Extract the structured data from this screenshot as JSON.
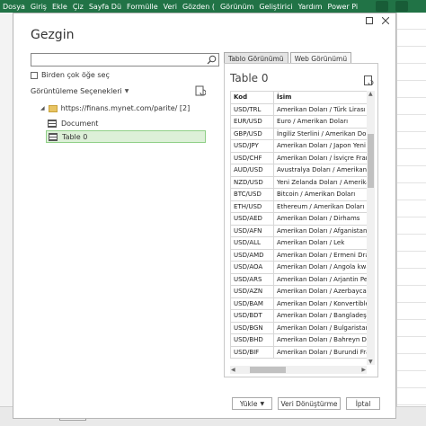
{
  "ribbon": {
    "tabs": [
      "Dosya",
      "Giriş",
      "Ekle",
      "Çiz",
      "Sayfa Dü",
      "Formülle",
      "Veri",
      "Gözden (",
      "Görünüm",
      "Geliştirici",
      "Yardım",
      "Power Pi"
    ]
  },
  "dialog": {
    "title": "Gezgin",
    "search": {
      "value": "",
      "placeholder": ""
    },
    "multi_select_label": "Birden çok öğe seç",
    "view_options_label": "Görüntüleme Seçenekleri",
    "tree": {
      "root_label": "https://finans.mynet.com/parite/ [2]",
      "items": [
        {
          "label": "Document",
          "selected": false
        },
        {
          "label": "Table 0",
          "selected": true
        }
      ]
    },
    "tabs": {
      "table_view": "Tablo Görünümü",
      "web_view": "Web Görünümü"
    },
    "preview": {
      "title": "Table 0",
      "columns": [
        "Kod",
        "İsim"
      ],
      "rows": [
        [
          "USD/TRL",
          "Amerikan Doları / Türk Lirası"
        ],
        [
          "EUR/USD",
          "Euro / Amerikan Doları"
        ],
        [
          "GBP/USD",
          "İngiliz Sterlini / Amerikan Dolar"
        ],
        [
          "USD/JPY",
          "Amerikan Doları / Japon Yeni"
        ],
        [
          "USD/CHF",
          "Amerikan Doları / İsviçre Frankı"
        ],
        [
          "AUD/USD",
          "Avustralya Doları / Amerikan Do"
        ],
        [
          "NZD/USD",
          "Yeni Zelanda Doları / Amerikan D"
        ],
        [
          "BTC/USD",
          "Bitcoin / Amerikan Doları"
        ],
        [
          "ETH/USD",
          "Ethereum / Amerikan Doları"
        ],
        [
          "USD/AED",
          "Amerikan Doları / Dirhams"
        ],
        [
          "USD/AFN",
          "Amerikan Doları / Afganistan Af"
        ],
        [
          "USD/ALL",
          "Amerikan Doları / Lek"
        ],
        [
          "USD/AMD",
          "Amerikan Doları / Ermeni Dram"
        ],
        [
          "USD/AOA",
          "Amerikan Doları / Angola kwanz"
        ],
        [
          "USD/ARS",
          "Amerikan Doları / Arjantin Peso"
        ],
        [
          "USD/AZN",
          "Amerikan Doları / Azerbaycan M"
        ],
        [
          "USD/BAM",
          "Amerikan Doları / Konvertible M"
        ],
        [
          "USD/BDT",
          "Amerikan Doları / Bangladeş Ta"
        ],
        [
          "USD/BGN",
          "Amerikan Doları / Bulgaristan Le"
        ],
        [
          "USD/BHD",
          "Amerikan Doları / Bahreyn Dina"
        ],
        [
          "USD/BIF",
          "Amerikan Doları / Burundi Frang"
        ]
      ]
    },
    "buttons": {
      "load": "Yükle",
      "transform": "Veri Dönüştürme",
      "cancel": "İptal"
    }
  }
}
